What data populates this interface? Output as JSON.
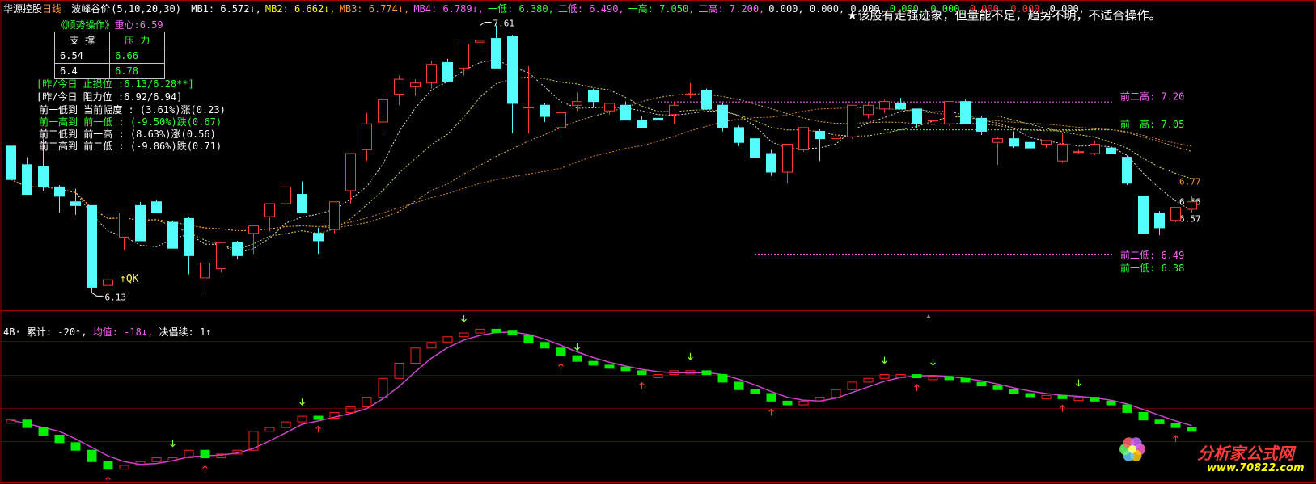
{
  "header": {
    "stock_name": "华源控股",
    "period": "日线",
    "indicator": "波峰谷价",
    "params": "(5,10,20,30)",
    "values": [
      {
        "label": "MB1: 6.572↓,",
        "color": "#ffffff"
      },
      {
        "label": "MB2: 6.662↓,",
        "color": "#ffff00"
      },
      {
        "label": "MB3: 6.774↓,",
        "color": "#ff9933"
      },
      {
        "label": "MB4: 6.789↓,",
        "color": "#ff66ff"
      },
      {
        "label": "一低: 6.380,",
        "color": "#33ff33"
      },
      {
        "label": "二低: 6.490,",
        "color": "#ff66ff"
      },
      {
        "label": "一高: 7.050,",
        "color": "#33ff33"
      },
      {
        "label": "二高: 7.200,",
        "color": "#ff66ff"
      },
      {
        "label": "0.000, 0.000, 0.000,",
        "color": "#ffffff"
      },
      {
        "label": "0.000, 0.000,",
        "color": "#33ff33"
      },
      {
        "label": "0.000, 0.000,",
        "color": "#ff3333"
      },
      {
        "label": "0.000,",
        "color": "#ffffff"
      }
    ]
  },
  "tip_text": "★该股有走强迹象，但量能不足，趋势不明，不适合操作。",
  "sr_table": {
    "title": "《顺势操作》",
    "center": "重心:6.59",
    "col_support": "支  撑",
    "col_resist": "压  力",
    "rows": [
      {
        "support": "6.54",
        "resist": "6.66"
      },
      {
        "support": "6.4",
        "resist": "6.78"
      }
    ]
  },
  "info_lines": {
    "stop_loss": "[昨/今日  止损位  :6.13/6.28**]",
    "resistance": "[昨/今日  阻力位  :6.92/6.94]",
    "line1": "前一低到 当前幅度  : (3.61%)涨(0.23)",
    "line2": "前一高到 前一低 : (-9.50%)跌(0.67)",
    "line3": "前二低到 前一高 : (8.63%)涨(0.56)",
    "line4": "前二高到 前二低 : (-9.86%)跌(0.71)"
  },
  "annotations": {
    "peak": "7.61",
    "low": "6.13",
    "qk": "↑QK",
    "prev2_high": "前二高: 7.20",
    "prev1_high": "前一高: 7.05",
    "prev2_low": "前二低: 6.49",
    "prev1_low": "前一低: 6.38",
    "right_1": "6.77",
    "right_2": "6.66",
    "right_3": "6.57"
  },
  "indicator_header": {
    "id": "4B·",
    "total": "累计: -20↑,",
    "avg": "均值: -18↓,",
    "cont": "决倡续: 1↑"
  },
  "watermark": {
    "name": "分析家公式网",
    "url": "www.70822.com"
  },
  "colors": {
    "up": "#ff3b3b",
    "down": "#54fcfc",
    "background": "#000000",
    "frame": "#a00000",
    "ind_up": "#ff2020",
    "ind_down": "#00ee00",
    "avg_line": "#cc44cc"
  },
  "chart_data": {
    "type": "candlestick",
    "candles": [
      {
        "o": 6.96,
        "h": 6.98,
        "l": 6.78,
        "c": 6.78
      },
      {
        "o": 6.86,
        "h": 6.9,
        "l": 6.7,
        "c": 6.7
      },
      {
        "o": 6.85,
        "h": 7.0,
        "l": 6.72,
        "c": 6.74
      },
      {
        "o": 6.74,
        "h": 6.75,
        "l": 6.6,
        "c": 6.69
      },
      {
        "o": 6.66,
        "h": 6.73,
        "l": 6.59,
        "c": 6.64
      },
      {
        "o": 6.64,
        "h": 6.64,
        "l": 6.17,
        "c": 6.2
      },
      {
        "o": 6.21,
        "h": 6.27,
        "l": 6.16,
        "c": 6.24
      },
      {
        "o": 6.47,
        "h": 6.55,
        "l": 6.4,
        "c": 6.6
      },
      {
        "o": 6.64,
        "h": 6.66,
        "l": 6.45,
        "c": 6.45
      },
      {
        "o": 6.66,
        "h": 6.67,
        "l": 6.6,
        "c": 6.6
      },
      {
        "o": 6.55,
        "h": 6.56,
        "l": 6.41,
        "c": 6.41
      },
      {
        "o": 6.57,
        "h": 6.58,
        "l": 6.27,
        "c": 6.37
      },
      {
        "o": 6.25,
        "h": 6.29,
        "l": 6.16,
        "c": 6.33
      },
      {
        "o": 6.3,
        "h": 6.42,
        "l": 6.28,
        "c": 6.44
      },
      {
        "o": 6.44,
        "h": 6.45,
        "l": 6.35,
        "c": 6.37
      },
      {
        "o": 6.49,
        "h": 6.5,
        "l": 6.38,
        "c": 6.53
      },
      {
        "o": 6.58,
        "h": 6.64,
        "l": 6.5,
        "c": 6.65
      },
      {
        "o": 6.65,
        "h": 6.74,
        "l": 6.58,
        "c": 6.74
      },
      {
        "o": 6.7,
        "h": 6.77,
        "l": 6.6,
        "c": 6.6
      },
      {
        "o": 6.49,
        "h": 6.52,
        "l": 6.38,
        "c": 6.45
      },
      {
        "o": 6.51,
        "h": 6.65,
        "l": 6.49,
        "c": 6.66
      },
      {
        "o": 6.72,
        "h": 6.84,
        "l": 6.65,
        "c": 6.92
      },
      {
        "o": 6.94,
        "h": 7.14,
        "l": 6.88,
        "c": 7.08
      },
      {
        "o": 7.09,
        "h": 7.24,
        "l": 7.02,
        "c": 7.21
      },
      {
        "o": 7.24,
        "h": 7.34,
        "l": 7.18,
        "c": 7.32
      },
      {
        "o": 7.28,
        "h": 7.32,
        "l": 7.23,
        "c": 7.3
      },
      {
        "o": 7.3,
        "h": 7.42,
        "l": 7.27,
        "c": 7.4
      },
      {
        "o": 7.41,
        "h": 7.43,
        "l": 7.31,
        "c": 7.31
      },
      {
        "o": 7.38,
        "h": 7.5,
        "l": 7.34,
        "c": 7.51
      },
      {
        "o": 7.52,
        "h": 7.61,
        "l": 7.48,
        "c": 7.53
      },
      {
        "o": 7.54,
        "h": 7.61,
        "l": 7.38,
        "c": 7.38
      },
      {
        "o": 7.55,
        "h": 7.56,
        "l": 7.03,
        "c": 7.19
      },
      {
        "o": 7.17,
        "h": 7.39,
        "l": 7.03,
        "c": 7.17
      },
      {
        "o": 7.18,
        "h": 7.19,
        "l": 7.09,
        "c": 7.12
      },
      {
        "o": 7.06,
        "h": 7.18,
        "l": 7.0,
        "c": 7.14
      },
      {
        "o": 7.18,
        "h": 7.25,
        "l": 7.15,
        "c": 7.2
      },
      {
        "o": 7.26,
        "h": 7.27,
        "l": 7.17,
        "c": 7.2
      },
      {
        "o": 7.15,
        "h": 7.19,
        "l": 7.13,
        "c": 7.19
      },
      {
        "o": 7.18,
        "h": 7.2,
        "l": 7.1,
        "c": 7.1
      },
      {
        "o": 7.1,
        "h": 7.12,
        "l": 7.06,
        "c": 7.06
      },
      {
        "o": 7.11,
        "h": 7.12,
        "l": 7.07,
        "c": 7.1
      },
      {
        "o": 7.13,
        "h": 7.2,
        "l": 7.08,
        "c": 7.18
      },
      {
        "o": 7.24,
        "h": 7.3,
        "l": 7.22,
        "c": 7.24
      },
      {
        "o": 7.26,
        "h": 7.27,
        "l": 7.16,
        "c": 7.16
      },
      {
        "o": 7.18,
        "h": 7.19,
        "l": 7.04,
        "c": 7.06
      },
      {
        "o": 7.06,
        "h": 7.07,
        "l": 6.96,
        "c": 6.98
      },
      {
        "o": 7.0,
        "h": 7.01,
        "l": 6.9,
        "c": 6.9
      },
      {
        "o": 6.92,
        "h": 6.94,
        "l": 6.8,
        "c": 6.82
      },
      {
        "o": 6.82,
        "h": 6.95,
        "l": 6.76,
        "c": 6.97
      },
      {
        "o": 6.94,
        "h": 7.04,
        "l": 6.93,
        "c": 7.06
      },
      {
        "o": 7.04,
        "h": 7.05,
        "l": 6.88,
        "c": 7.0
      },
      {
        "o": 7.0,
        "h": 7.02,
        "l": 6.96,
        "c": 7.01
      },
      {
        "o": 7.01,
        "h": 7.14,
        "l": 7.0,
        "c": 7.18
      },
      {
        "o": 7.13,
        "h": 7.19,
        "l": 7.11,
        "c": 7.18
      },
      {
        "o": 7.16,
        "h": 7.21,
        "l": 7.14,
        "c": 7.2
      },
      {
        "o": 7.19,
        "h": 7.22,
        "l": 7.16,
        "c": 7.16
      },
      {
        "o": 7.16,
        "h": 7.16,
        "l": 7.06,
        "c": 7.08
      },
      {
        "o": 7.1,
        "h": 7.16,
        "l": 7.08,
        "c": 7.1
      },
      {
        "o": 7.08,
        "h": 7.19,
        "l": 7.07,
        "c": 7.2
      },
      {
        "o": 7.2,
        "h": 7.21,
        "l": 7.08,
        "c": 7.08
      },
      {
        "o": 7.11,
        "h": 7.12,
        "l": 7.02,
        "c": 7.04
      },
      {
        "o": 6.98,
        "h": 7.01,
        "l": 6.86,
        "c": 7.0
      },
      {
        "o": 7.0,
        "h": 7.04,
        "l": 6.95,
        "c": 6.96
      },
      {
        "o": 6.98,
        "h": 7.02,
        "l": 6.96,
        "c": 6.95
      },
      {
        "o": 6.97,
        "h": 6.99,
        "l": 6.95,
        "c": 6.99
      },
      {
        "o": 6.88,
        "h": 7.03,
        "l": 6.87,
        "c": 6.97
      },
      {
        "o": 6.93,
        "h": 6.94,
        "l": 6.92,
        "c": 6.93
      },
      {
        "o": 6.92,
        "h": 6.99,
        "l": 6.91,
        "c": 6.97
      },
      {
        "o": 6.95,
        "h": 6.98,
        "l": 6.92,
        "c": 6.92
      },
      {
        "o": 6.9,
        "h": 6.91,
        "l": 6.75,
        "c": 6.76
      },
      {
        "o": 6.69,
        "h": 6.69,
        "l": 6.49,
        "c": 6.49
      },
      {
        "o": 6.6,
        "h": 6.61,
        "l": 6.48,
        "c": 6.52
      },
      {
        "o": 6.56,
        "h": 6.63,
        "l": 6.55,
        "c": 6.63
      },
      {
        "o": 6.62,
        "h": 6.69,
        "l": 6.6,
        "c": 6.66
      }
    ],
    "indicator": [
      -14,
      -18,
      -22,
      -26,
      -30,
      -36,
      -40,
      -38,
      -36,
      -34,
      -34,
      -30,
      -34,
      -32,
      -30,
      -20,
      -18,
      -15,
      -12,
      -13,
      -10,
      -7,
      -2,
      8,
      16,
      24,
      27,
      30,
      32,
      34,
      33,
      31,
      27,
      24,
      20,
      17,
      15,
      14,
      12,
      10,
      10,
      12,
      12,
      10,
      6,
      2,
      0,
      -4,
      -6,
      -4,
      -2,
      2,
      6,
      8,
      10,
      10,
      9,
      9,
      8,
      6,
      4,
      2,
      0,
      -1,
      -1,
      -2,
      -2,
      -4,
      -6,
      -10,
      -14,
      -16,
      -18,
      -20
    ],
    "ylim": [
      6.08,
      7.66
    ]
  }
}
